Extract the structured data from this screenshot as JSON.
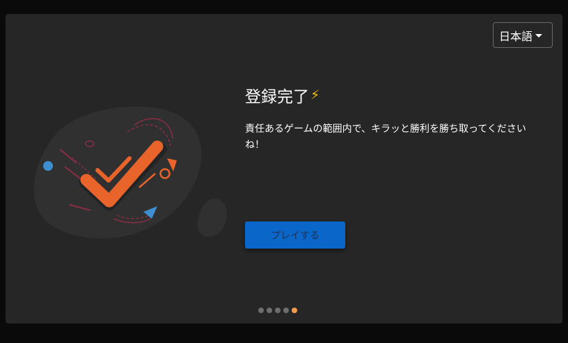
{
  "language_select": {
    "value": "日本語",
    "icon": "caret-down-icon"
  },
  "onboarding": {
    "title": "登録完了",
    "title_icon": "⚡",
    "description": "責任あるゲームの範囲内で、キラッと勝利を勝ち取ってくださいね！",
    "play_button_label": "プレイする"
  },
  "pagination": {
    "total": 5,
    "active_index": 4
  },
  "colors": {
    "background": "#0a0a0a",
    "card": "#262626",
    "accent_orange": "#e8642b",
    "button_blue": "#0a66c8",
    "active_dot": "#f39c4a"
  }
}
